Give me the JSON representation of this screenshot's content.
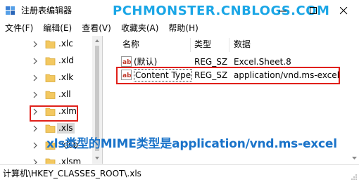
{
  "window": {
    "title": "注册表编辑器",
    "watermark": "PCHMONSTER.CNBLOGS.COM"
  },
  "menu": [
    "文件(F)",
    "编辑(E)",
    "查看(V)",
    "收藏夹(A)",
    "帮助(H)"
  ],
  "tree": {
    "items": [
      {
        "label": ".xlc"
      },
      {
        "label": ".xld"
      },
      {
        "label": ".xlk"
      },
      {
        "label": ".xll"
      },
      {
        "label": ".xlm"
      },
      {
        "label": ".xls",
        "selected": true
      },
      {
        "label": ".xlsb"
      },
      {
        "label": ".xlsm"
      }
    ]
  },
  "list": {
    "headers": {
      "name": "名称",
      "type": "类型",
      "data": "数据"
    },
    "rows": [
      {
        "name": "(默认)",
        "type": "REG_SZ",
        "data": "Excel.Sheet.8"
      },
      {
        "name": "Content Type",
        "type": "REG_SZ",
        "data": "application/vnd.ms-excel"
      }
    ]
  },
  "caption": "xls类型的MIME类型是application/vnd.ms-excel",
  "status": {
    "path": "计算机\\HKEY_CLASSES_ROOT\\.xls"
  },
  "colors": {
    "highlight_border": "#e0201a",
    "watermark": "#1aa6e6",
    "caption": "#1a73c9",
    "folder": "#f3c860"
  }
}
